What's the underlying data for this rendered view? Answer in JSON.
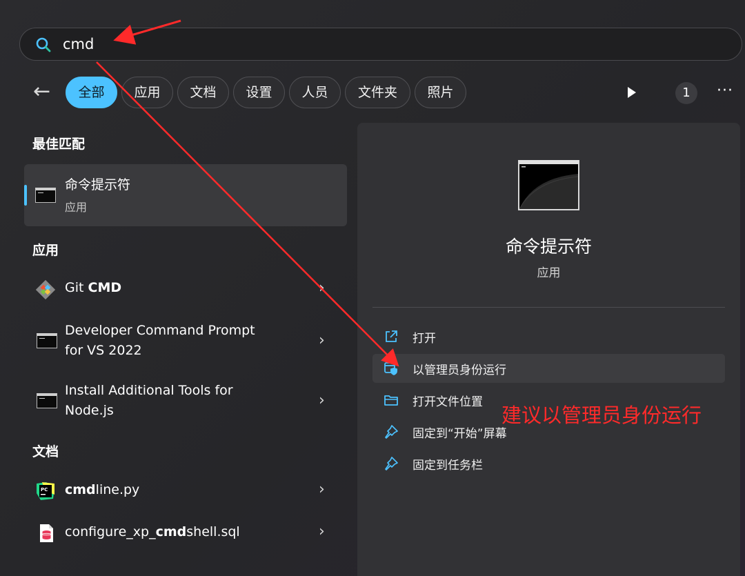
{
  "search": {
    "value": "cmd",
    "placeholder": ""
  },
  "filters": {
    "back_label": "←",
    "chips": [
      "全部",
      "应用",
      "文档",
      "设置",
      "人员",
      "文件夹",
      "照片"
    ],
    "active_index": 0,
    "count": "1",
    "more_label": "···"
  },
  "left": {
    "best_match_title": "最佳匹配",
    "best_match": {
      "title": "命令提示符",
      "subtitle": "应用"
    },
    "apps_title": "应用",
    "apps": [
      {
        "pre": "Git ",
        "bold": "CMD",
        "post": ""
      },
      {
        "line1": "Developer Command Prompt",
        "line2": "for VS 2022"
      },
      {
        "line1": "Install Additional Tools for",
        "line2": "Node.js"
      }
    ],
    "docs_title": "文档",
    "docs": [
      {
        "pre": "",
        "bold": "cmd",
        "post": "line.py"
      },
      {
        "pre": "configure_xp_",
        "bold": "cmd",
        "post": "shell.sql"
      }
    ],
    "chevron": "›"
  },
  "detail": {
    "title": "命令提示符",
    "subtitle": "应用",
    "actions": [
      {
        "label": "打开",
        "icon": "open-external-icon"
      },
      {
        "label": "以管理员身份运行",
        "icon": "admin-shield-icon"
      },
      {
        "label": "打开文件位置",
        "icon": "folder-icon"
      },
      {
        "label": "固定到“开始”屏幕",
        "icon": "pin-icon"
      },
      {
        "label": "固定到任务栏",
        "icon": "pin-icon"
      }
    ]
  },
  "annotation": {
    "text": "建议以管理员身份运行",
    "color": "#ff2a2a"
  },
  "colors": {
    "accent": "#4cc2ff",
    "panel": "#323235",
    "arrow": "#ff2a2a"
  }
}
